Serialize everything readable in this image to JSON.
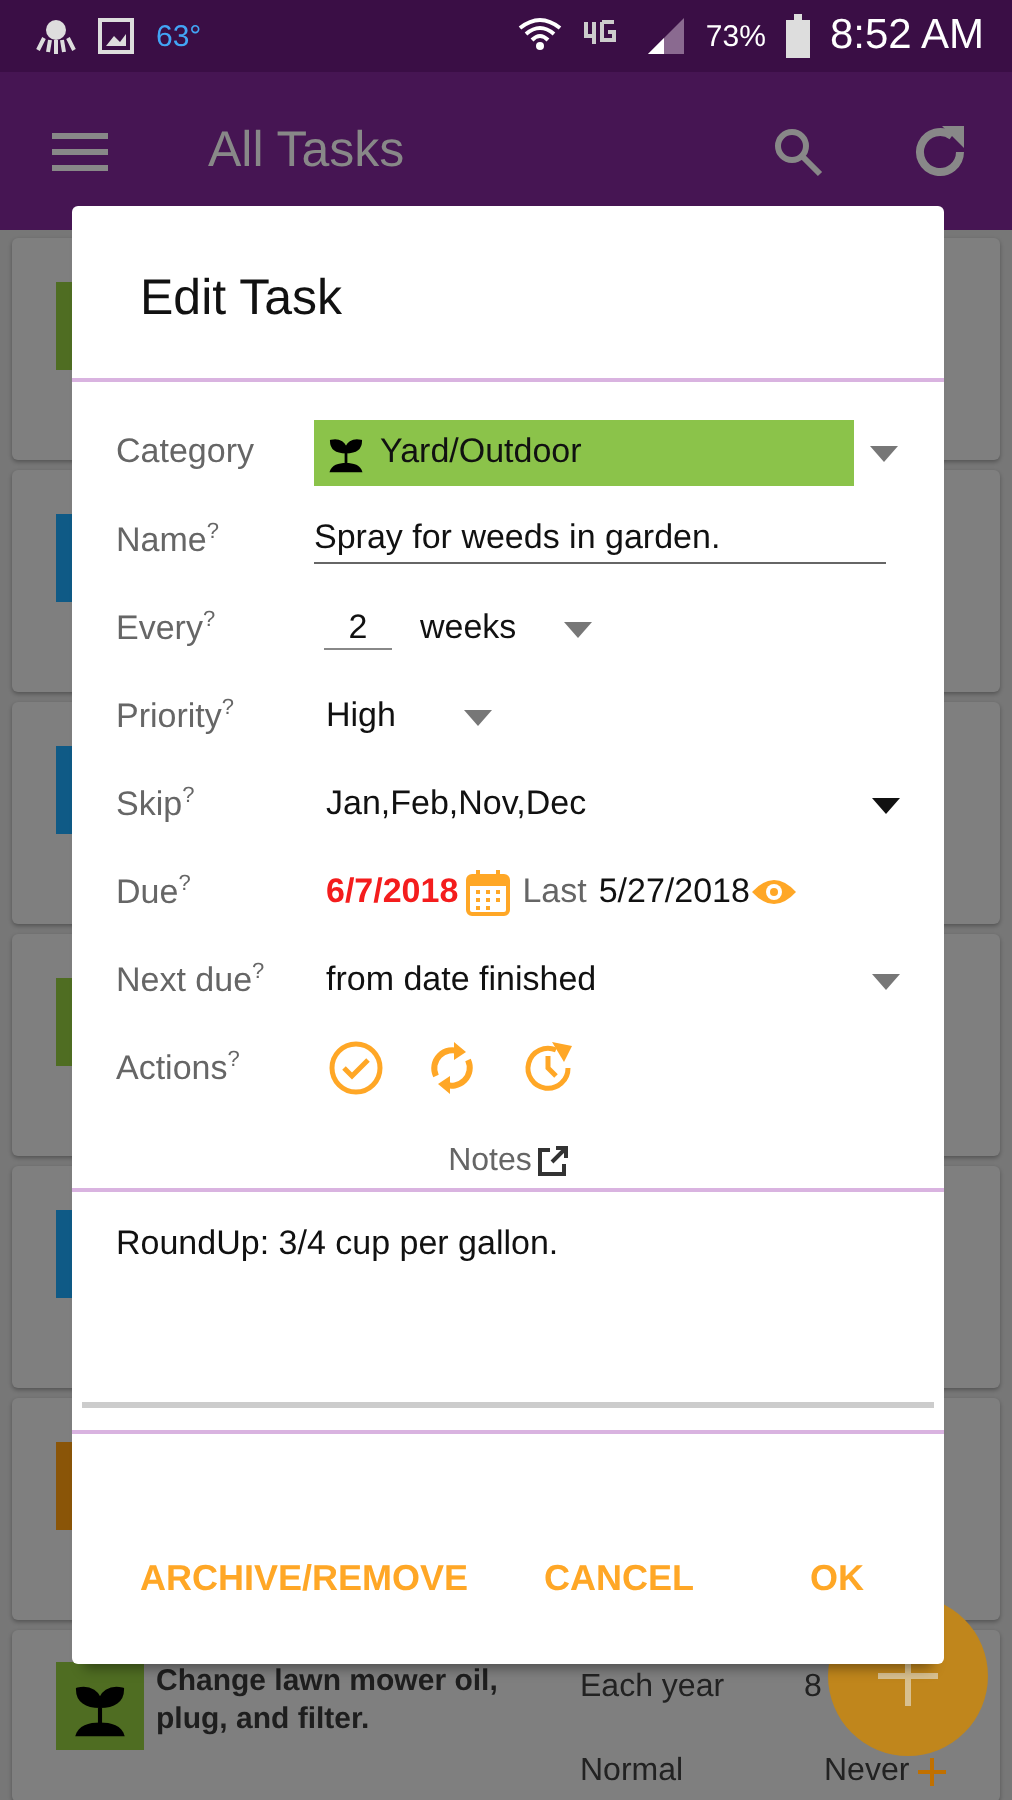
{
  "status_bar": {
    "temperature": "63°",
    "battery": "73%",
    "time": "8:52 AM"
  },
  "app_bar": {
    "title": "All Tasks"
  },
  "tasks": [
    {
      "kind": "partial",
      "color": "#4f6d22"
    },
    {
      "kind": "partial",
      "color": "#0f5a86"
    },
    {
      "kind": "partial",
      "color": "#0f5a86"
    },
    {
      "kind": "partial",
      "color": "#4f6d22"
    },
    {
      "kind": "partial",
      "color": "#0f5a86"
    },
    {
      "kind": "partial",
      "color": "#8a5508"
    },
    {
      "kind": "detailed",
      "color": "#4f6d22",
      "name": "Change lawn mower oil, plug, and filter.",
      "frequency": "Each year",
      "due": "8",
      "priority": "Normal",
      "last": "Never"
    }
  ],
  "dialog": {
    "title": "Edit Task",
    "fields": [
      {
        "kind": "category",
        "label": "Category",
        "value": "Yard/Outdoor",
        "color": "#8bc34a"
      },
      {
        "kind": "text",
        "label": "Name$^{?}$",
        "value": "Spray for weeds in garden."
      },
      {
        "kind": "every",
        "label": "Every$^{?}$",
        "number": "2",
        "unit": "weeks"
      },
      {
        "kind": "inline-select",
        "label": "Priority$^{?}$",
        "value": "High"
      },
      {
        "kind": "dropdown",
        "label": "Skip$^{?}$",
        "value": "Jan,Feb,Nov,Dec"
      },
      {
        "kind": "due",
        "label": "Due$^{?}$",
        "value": "6/7/2018",
        "overdue": true,
        "last_label": "Last",
        "last_value": "5/27/2018"
      },
      {
        "kind": "dropdown",
        "label": "Next due$^{?}$",
        "value": "from date finished"
      },
      {
        "kind": "actions",
        "label": "Actions$^{?}$"
      }
    ],
    "notes": {
      "label": "Notes",
      "text": "RoundUp: 3/4 cup per gallon."
    },
    "buttons": [
      "ARCHIVE/REMOVE",
      "CANCEL",
      "OK"
    ]
  }
}
